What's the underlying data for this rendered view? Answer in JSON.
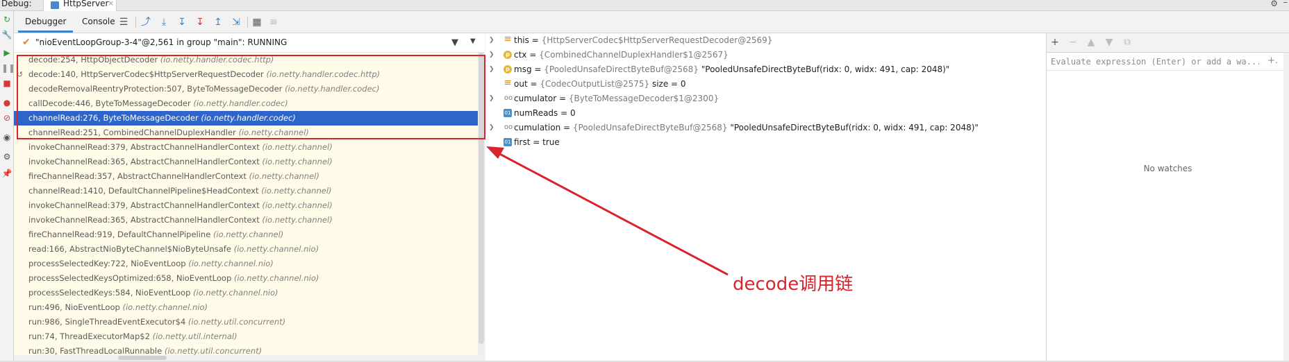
{
  "window": {
    "debug_label": "Debug:",
    "run_tab_label": "HttpServer",
    "run_tab_close": "×"
  },
  "toolbar": {
    "tab_debugger": "Debugger",
    "tab_console": "Console"
  },
  "thread": {
    "label": "\"nioEventLoopGroup-3-4\"@2,561 in group \"main\": RUNNING"
  },
  "frames": [
    {
      "method": "decode:254, HttpObjectDecoder",
      "pkg": "(io.netty.handler.codec.http)"
    },
    {
      "method": "decode:140, HttpServerCodec$HttpServerRequestDecoder",
      "pkg": "(io.netty.handler.codec.http)"
    },
    {
      "method": "decodeRemovalReentryProtection:507, ByteToMessageDecoder",
      "pkg": "(io.netty.handler.codec)"
    },
    {
      "method": "callDecode:446, ByteToMessageDecoder",
      "pkg": "(io.netty.handler.codec)"
    },
    {
      "method": "channelRead:276, ByteToMessageDecoder",
      "pkg": "(io.netty.handler.codec)"
    },
    {
      "method": "channelRead:251, CombinedChannelDuplexHandler",
      "pkg": "(io.netty.channel)"
    },
    {
      "method": "invokeChannelRead:379, AbstractChannelHandlerContext",
      "pkg": "(io.netty.channel)"
    },
    {
      "method": "invokeChannelRead:365, AbstractChannelHandlerContext",
      "pkg": "(io.netty.channel)"
    },
    {
      "method": "fireChannelRead:357, AbstractChannelHandlerContext",
      "pkg": "(io.netty.channel)"
    },
    {
      "method": "channelRead:1410, DefaultChannelPipeline$HeadContext",
      "pkg": "(io.netty.channel)"
    },
    {
      "method": "invokeChannelRead:379, AbstractChannelHandlerContext",
      "pkg": "(io.netty.channel)"
    },
    {
      "method": "invokeChannelRead:365, AbstractChannelHandlerContext",
      "pkg": "(io.netty.channel)"
    },
    {
      "method": "fireChannelRead:919, DefaultChannelPipeline",
      "pkg": "(io.netty.channel)"
    },
    {
      "method": "read:166, AbstractNioByteChannel$NioByteUnsafe",
      "pkg": "(io.netty.channel.nio)"
    },
    {
      "method": "processSelectedKey:722, NioEventLoop",
      "pkg": "(io.netty.channel.nio)"
    },
    {
      "method": "processSelectedKeysOptimized:658, NioEventLoop",
      "pkg": "(io.netty.channel.nio)"
    },
    {
      "method": "processSelectedKeys:584, NioEventLoop",
      "pkg": "(io.netty.channel.nio)"
    },
    {
      "method": "run:496, NioEventLoop",
      "pkg": "(io.netty.channel.nio)"
    },
    {
      "method": "run:986, SingleThreadEventExecutor$4",
      "pkg": "(io.netty.util.concurrent)"
    },
    {
      "method": "run:74, ThreadExecutorMap$2",
      "pkg": "(io.netty.util.internal)"
    },
    {
      "method": "run:30, FastThreadLocalRunnable",
      "pkg": "(io.netty.util.concurrent)"
    }
  ],
  "variables": [
    {
      "name": "this",
      "type": "{HttpServerCodec$HttpServerRequestDecoder@2569}",
      "value": ""
    },
    {
      "name": "ctx",
      "type": "{CombinedChannelDuplexHandler$1@2567}",
      "value": ""
    },
    {
      "name": "msg",
      "type": "{PooledUnsafeDirectByteBuf@2568}",
      "value": "\"PooledUnsafeDirectByteBuf(ridx: 0, widx: 491, cap: 2048)\""
    },
    {
      "name": "out",
      "type": "{CodecOutputList@2575}",
      "value": " size = 0"
    },
    {
      "name": "cumulator",
      "type": "{ByteToMessageDecoder$1@2300}",
      "value": ""
    },
    {
      "name": "numReads",
      "type": "",
      "value": "0"
    },
    {
      "name": "cumulation",
      "type": "{PooledUnsafeDirectByteBuf@2568}",
      "value": "\"PooledUnsafeDirectByteBuf(ridx: 0, widx: 491, cap: 2048)\""
    },
    {
      "name": "first",
      "type": "",
      "value": "true"
    }
  ],
  "watches": {
    "placeholder": "Evaluate expression (Enter) or add a wa...",
    "empty_text": "No watches"
  },
  "annotation": {
    "text": "decode调用链",
    "color": "#d8242c"
  },
  "colors": {
    "selection": "#2f65ca",
    "frames_bg": "#fffbe8",
    "accent_tab": "#4083c9"
  }
}
